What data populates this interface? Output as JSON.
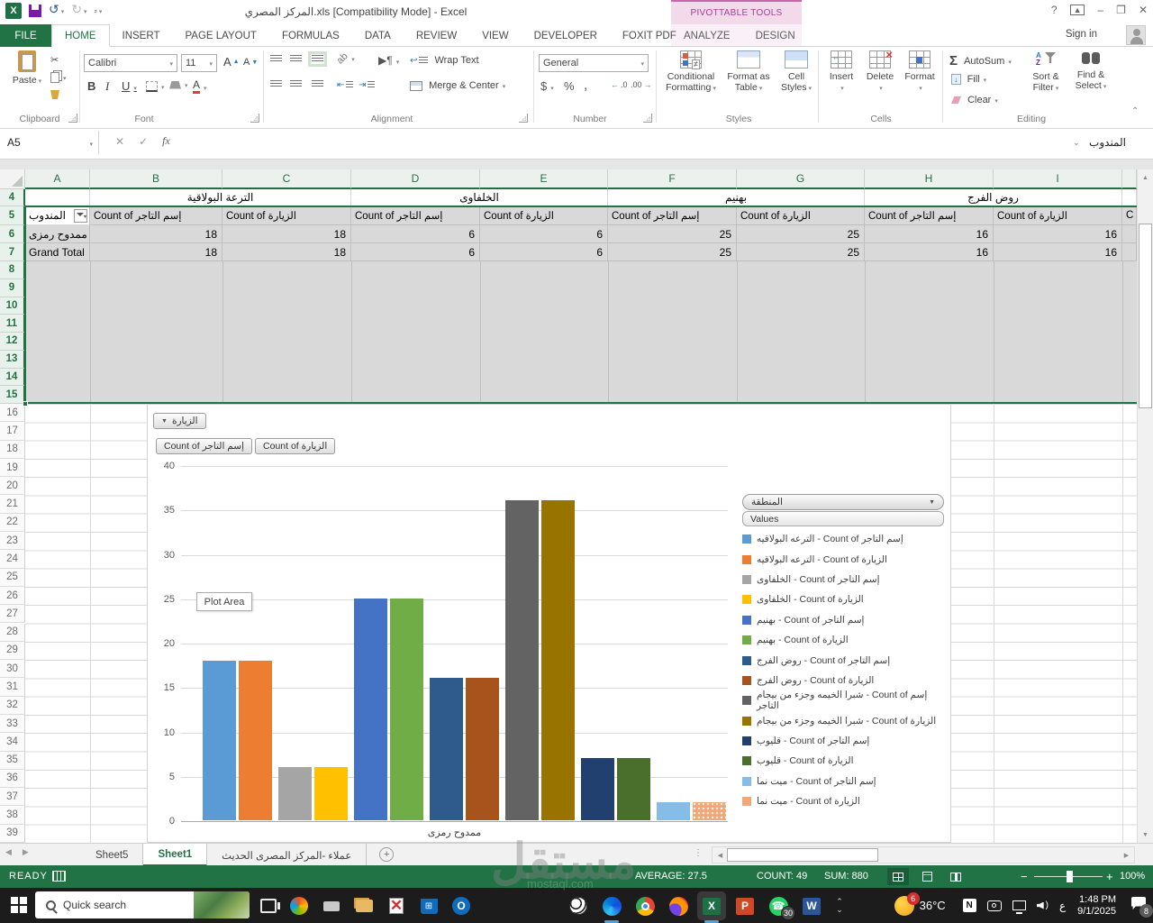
{
  "titlebar": {
    "title": "المركز المصري.xls  [Compatibility Mode] - Excel",
    "contextual_label": "PIVOTTABLE TOOLS",
    "help": "?",
    "minimize": "–",
    "restore": "❐",
    "close": "✕",
    "sign_in": "Sign in"
  },
  "tabs": {
    "file": "FILE",
    "main": [
      "HOME",
      "INSERT",
      "PAGE LAYOUT",
      "FORMULAS",
      "DATA",
      "REVIEW",
      "VIEW",
      "DEVELOPER",
      "FOXIT PDF"
    ],
    "contextual": [
      "ANALYZE",
      "DESIGN"
    ],
    "active": "HOME"
  },
  "ribbon": {
    "clipboard": {
      "label": "Clipboard",
      "paste": "Paste"
    },
    "font": {
      "label": "Font",
      "font_name": "Calibri",
      "font_size": "11",
      "bold": "B",
      "italic": "I",
      "underline": "U"
    },
    "alignment": {
      "label": "Alignment",
      "wrap_text": "Wrap Text",
      "merge_center": "Merge & Center"
    },
    "number": {
      "label": "Number",
      "format": "General",
      "currency": "$",
      "percent": "%",
      "comma": ",",
      "inc_dec": ".00",
      "dec_dec": ".0"
    },
    "styles": {
      "label": "Styles",
      "conditional_1": "Conditional",
      "conditional_2": "Formatting",
      "format_table_1": "Format as",
      "format_table_2": "Table",
      "cell_styles_1": "Cell",
      "cell_styles_2": "Styles"
    },
    "cells": {
      "label": "Cells",
      "insert": "Insert",
      "delete": "Delete",
      "format": "Format"
    },
    "editing": {
      "label": "Editing",
      "autosum": "AutoSum",
      "fill": "Fill",
      "clear": "Clear",
      "sort_1": "Sort &",
      "sort_2": "Filter",
      "find_1": "Find &",
      "find_2": "Select"
    }
  },
  "formula_bar": {
    "name_box": "A5",
    "fx": "fx",
    "cancel": "✕",
    "enter": "✓",
    "value": "المندوب"
  },
  "grid": {
    "column_letters": [
      "A",
      "B",
      "C",
      "D",
      "E",
      "F",
      "G",
      "H",
      "I"
    ],
    "row_numbers_start": 4,
    "row_numbers_end": 39,
    "pivot": {
      "row_label_header": "المندوب",
      "regions": [
        "الترعة البولاقية",
        "الخلفاوى",
        "بهنيم",
        "روض الفرج"
      ],
      "value_header_trader": "Count of إسم التاجر",
      "value_header_visit": "Count of الزيارة",
      "rows": [
        {
          "label": "ممدوح رمزى",
          "values": [
            18,
            18,
            6,
            6,
            25,
            25,
            16,
            16
          ]
        },
        {
          "label": "Grand Total",
          "values": [
            18,
            18,
            6,
            6,
            25,
            25,
            16,
            16
          ]
        }
      ],
      "partial_next_cell": "C"
    }
  },
  "chart_data": {
    "type": "bar",
    "category": "ممدوح رمزى",
    "xlabel": "ممدوح رمزى",
    "ylim": [
      0,
      40
    ],
    "ytick_step": 5,
    "grid": true,
    "legend_position": "right",
    "filter_button": "الزيارة",
    "field_buttons": [
      "Count of إسم التاجر",
      "Count of الزيارة"
    ],
    "legend_dropdown": "المنطقة",
    "legend_values_label": "Values",
    "plot_area_label": "Plot Area",
    "series": [
      {
        "name": "الترعه البولاقيه - Count of إسم التاجر",
        "value": 18,
        "color": "#5B9BD5"
      },
      {
        "name": "الترعه البولاقيه - Count of الزيارة",
        "value": 18,
        "color": "#ED7D31"
      },
      {
        "name": "الخلفاوى - Count of إسم التاجر",
        "value": 6,
        "color": "#A5A5A5"
      },
      {
        "name": "الخلفاوى - Count of الزيارة",
        "value": 6,
        "color": "#FFC000"
      },
      {
        "name": "بهنيم - Count of إسم التاجر",
        "value": 25,
        "color": "#4472C4"
      },
      {
        "name": "بهنيم - Count of الزيارة",
        "value": 25,
        "color": "#70AD47"
      },
      {
        "name": "روض الفرج - Count of إسم التاجر",
        "value": 16,
        "color": "#2E5B8C"
      },
      {
        "name": "روض الفرج - Count of الزيارة",
        "value": 16,
        "color": "#A8531B"
      },
      {
        "name": "شبرا الخيمه وجزء من بيجام - Count of إسم التاجر",
        "value": 36,
        "color": "#636363"
      },
      {
        "name": "شبرا الخيمه وجزء من بيجام - Count of الزيارة",
        "value": 36,
        "color": "#997300"
      },
      {
        "name": "قليوب - Count of إسم التاجر",
        "value": 7,
        "color": "#21406F"
      },
      {
        "name": "قليوب - Count of الزيارة",
        "value": 7,
        "color": "#4A6E2B"
      },
      {
        "name": "ميت نما - Count of إسم التاجر",
        "value": 2,
        "color": "#86BCE8"
      },
      {
        "name": "ميت نما - Count of الزيارة",
        "value": 2,
        "color": "#F2A778",
        "pattern": true
      }
    ]
  },
  "sheet_tabs": {
    "tabs": [
      "Sheet5",
      "Sheet1",
      "عملاء -المركز المصرى الحديث"
    ],
    "active": "Sheet1",
    "add_label": "+"
  },
  "status_bar": {
    "mode": "READY",
    "average": "AVERAGE: 27.5",
    "count": "COUNT: 49",
    "sum": "SUM: 880",
    "zoom_out": "−",
    "zoom_in": "+",
    "zoom_level": "100%"
  },
  "taskbar": {
    "search_placeholder": "Quick search",
    "temperature": "36°C",
    "time": "1:48 PM",
    "date": "9/1/2025",
    "language": "ع",
    "whatsapp_badge": "30",
    "weather_badge": "6",
    "notification_badge": "8",
    "app_letters": {
      "excel": "X",
      "word": "W",
      "powerpoint": "P",
      "outlook": "O",
      "notion": "N"
    }
  },
  "watermark": {
    "text": "مستقل",
    "domain": "mostaql.com"
  },
  "colors": {
    "excel_green": "#217346",
    "pivottools_pink": "#A33E97",
    "selection_gray": "#D9D9D9",
    "taskbar_active_underline": "#4CA3E0"
  }
}
